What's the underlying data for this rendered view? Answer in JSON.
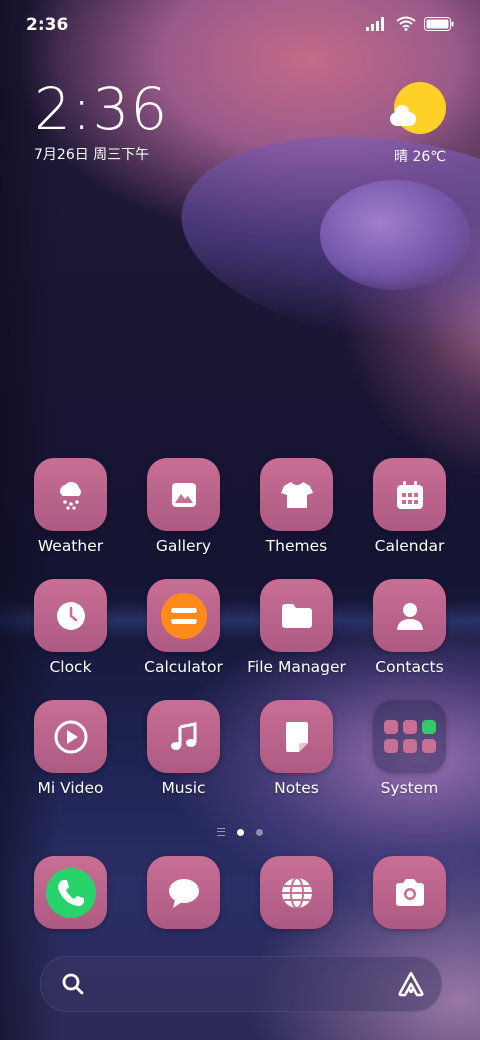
{
  "status_bar": {
    "time": "2:36"
  },
  "clock_widget": {
    "time": "2:36",
    "date": "7月26日 周三下午"
  },
  "weather_widget": {
    "text": "晴 26℃",
    "icon": "sun-cloud-icon"
  },
  "colors": {
    "icon_bg": "#c86f95",
    "weather_sun": "#ffd026",
    "phone_green": "#28d36b",
    "calculator_orange": "#ff8a1c"
  },
  "apps": [
    {
      "label": "Weather",
      "icon": "weather-snow-cloud-icon"
    },
    {
      "label": "Gallery",
      "icon": "image-icon"
    },
    {
      "label": "Themes",
      "icon": "tshirt-icon"
    },
    {
      "label": "Calendar",
      "icon": "calendar-icon"
    },
    {
      "label": "Clock",
      "icon": "clock-icon"
    },
    {
      "label": "Calculator",
      "icon": "calculator-icon"
    },
    {
      "label": "File Manager",
      "icon": "folder-icon"
    },
    {
      "label": "Contacts",
      "icon": "person-icon"
    },
    {
      "label": "Mi Video",
      "icon": "play-icon"
    },
    {
      "label": "Music",
      "icon": "music-note-icon"
    },
    {
      "label": "Notes",
      "icon": "note-icon"
    },
    {
      "label": "System",
      "icon": "folder-grid-icon"
    }
  ],
  "page_indicator": {
    "pages": 2,
    "active": 1
  },
  "dock": [
    {
      "icon": "phone-icon"
    },
    {
      "icon": "chat-bubble-icon"
    },
    {
      "icon": "globe-icon"
    },
    {
      "icon": "camera-icon"
    }
  ],
  "search": {
    "icon": "search-icon",
    "assistant_icon": "assistant-icon"
  }
}
